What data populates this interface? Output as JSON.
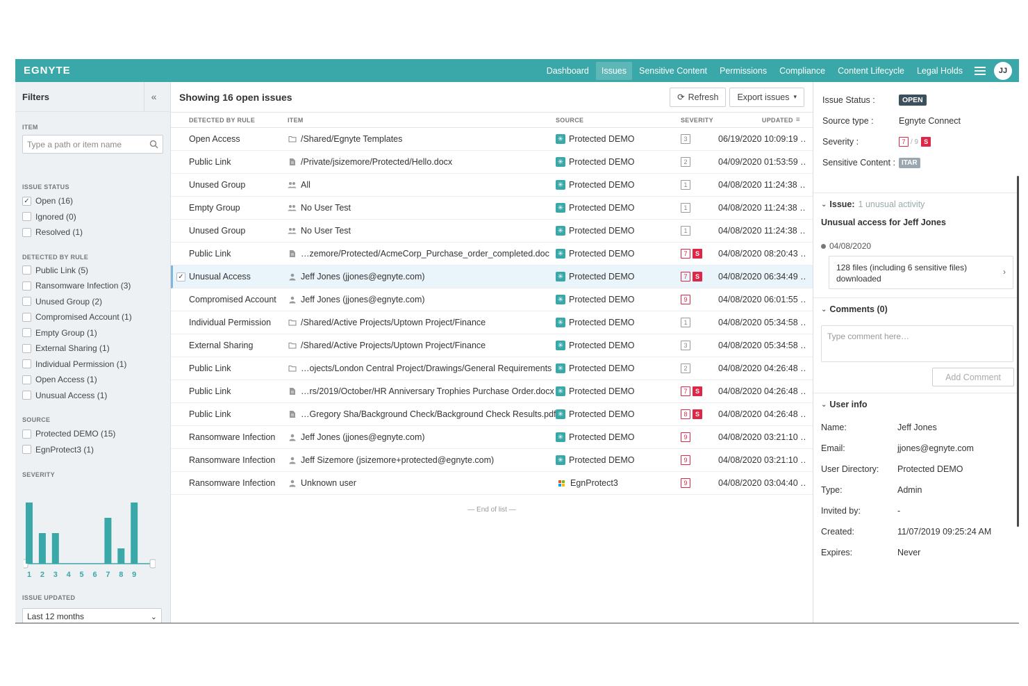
{
  "header": {
    "logo": "EGNYTE",
    "nav": [
      "Dashboard",
      "Issues",
      "Sensitive Content",
      "Permissions",
      "Compliance",
      "Content Lifecycle",
      "Legal Holds"
    ],
    "active_nav": "Issues",
    "avatar": "JJ"
  },
  "sidebar": {
    "title": "Filters",
    "collapse": "«",
    "item_label": "ITEM",
    "search_placeholder": "Type a path or item name",
    "issue_status_label": "ISSUE STATUS",
    "issue_status": [
      {
        "label": "Open (16)",
        "checked": true
      },
      {
        "label": "Ignored (0)",
        "checked": false
      },
      {
        "label": "Resolved (1)",
        "checked": false
      }
    ],
    "rule_label": "DETECTED BY RULE",
    "rules": [
      "Public Link (5)",
      "Ransomware Infection (3)",
      "Unused Group (2)",
      "Compromised Account (1)",
      "Empty Group (1)",
      "External Sharing (1)",
      "Individual Permission (1)",
      "Open Access (1)",
      "Unusual Access (1)"
    ],
    "source_label": "SOURCE",
    "sources": [
      "Protected DEMO (15)",
      "EgnProtect3 (1)"
    ],
    "severity_label": "SEVERITY",
    "severity_ticks": [
      "1",
      "2",
      "3",
      "4",
      "5",
      "6",
      "7",
      "8",
      "9"
    ],
    "severity_counts": [
      4,
      2,
      2,
      0,
      0,
      0,
      3,
      1,
      4
    ],
    "issue_updated_label": "ISSUE UPDATED",
    "issue_updated_value": "Last 12 months"
  },
  "main": {
    "title": "Showing 16 open issues",
    "refresh": "Refresh",
    "export": "Export issues",
    "columns": {
      "rule": "DETECTED BY RULE",
      "item": "ITEM",
      "source": "SOURCE",
      "severity": "SEVERITY",
      "updated": "UPDATED"
    },
    "rows": [
      {
        "rule": "Open Access",
        "icon": "folder-icon",
        "item": "/Shared/Egnyte Templates",
        "source": "Protected DEMO",
        "sev": "3",
        "s": false,
        "red": false,
        "updated": "06/19/2020 10:09:19 …"
      },
      {
        "rule": "Public Link",
        "icon": "file-icon",
        "item": "/Private/jsizemore/Protected/Hello.docx",
        "source": "Protected DEMO",
        "sev": "2",
        "s": false,
        "red": false,
        "updated": "04/09/2020 01:53:59 …"
      },
      {
        "rule": "Unused Group",
        "icon": "group-icon",
        "item": "All",
        "source": "Protected DEMO",
        "sev": "1",
        "s": false,
        "red": false,
        "updated": "04/08/2020 11:24:38 …"
      },
      {
        "rule": "Empty Group",
        "icon": "group-icon",
        "item": "No User Test",
        "source": "Protected DEMO",
        "sev": "1",
        "s": false,
        "red": false,
        "updated": "04/08/2020 11:24:38 …"
      },
      {
        "rule": "Unused Group",
        "icon": "group-icon",
        "item": "No User Test",
        "source": "Protected DEMO",
        "sev": "1",
        "s": false,
        "red": false,
        "updated": "04/08/2020 11:24:38 …"
      },
      {
        "rule": "Public Link",
        "icon": "file-icon",
        "item": "…zemore/Protected/AcmeCorp_Purchase_order_completed.doc",
        "source": "Protected DEMO",
        "sev": "7",
        "s": true,
        "red": true,
        "updated": "04/08/2020 08:20:43 …"
      },
      {
        "rule": "Unusual Access",
        "icon": "user-icon",
        "item": "Jeff Jones (jjones@egnyte.com)",
        "source": "Protected DEMO",
        "sev": "7",
        "s": true,
        "red": true,
        "updated": "04/08/2020 06:34:49 …",
        "selected": true
      },
      {
        "rule": "Compromised Account",
        "icon": "user-icon",
        "item": "Jeff Jones (jjones@egnyte.com)",
        "source": "Protected DEMO",
        "sev": "9",
        "s": false,
        "red": true,
        "updated": "04/08/2020 06:01:55 …"
      },
      {
        "rule": "Individual Permission",
        "icon": "folder-icon",
        "item": "/Shared/Active Projects/Uptown Project/Finance",
        "source": "Protected DEMO",
        "sev": "1",
        "s": false,
        "red": false,
        "updated": "04/08/2020 05:34:58 …"
      },
      {
        "rule": "External Sharing",
        "icon": "folder-icon",
        "item": "/Shared/Active Projects/Uptown Project/Finance",
        "source": "Protected DEMO",
        "sev": "3",
        "s": false,
        "red": false,
        "updated": "04/08/2020 05:34:58 …"
      },
      {
        "rule": "Public Link",
        "icon": "folder-icon",
        "item": "…ojects/London Central Project/Drawings/General Requirements",
        "source": "Protected DEMO",
        "sev": "2",
        "s": false,
        "red": false,
        "updated": "04/08/2020 04:26:48 …"
      },
      {
        "rule": "Public Link",
        "icon": "file-icon",
        "item": "…rs/2019/October/HR Anniversary Trophies Purchase Order.docx",
        "source": "Protected DEMO",
        "sev": "7",
        "s": true,
        "red": true,
        "updated": "04/08/2020 04:26:48 …"
      },
      {
        "rule": "Public Link",
        "icon": "file-icon",
        "item": "…Gregory Sha/Background Check/Background Check Results.pdf",
        "source": "Protected DEMO",
        "sev": "8",
        "s": true,
        "red": true,
        "updated": "04/08/2020 04:26:48 …"
      },
      {
        "rule": "Ransomware Infection",
        "icon": "user-icon",
        "item": "Jeff Jones (jjones@egnyte.com)",
        "source": "Protected DEMO",
        "sev": "9",
        "s": false,
        "red": true,
        "updated": "04/08/2020 03:21:10 …"
      },
      {
        "rule": "Ransomware Infection",
        "icon": "user-icon",
        "item": "Jeff Sizemore (jsizemore+protected@egnyte.com)",
        "source": "Protected DEMO",
        "sev": "9",
        "s": false,
        "red": true,
        "updated": "04/08/2020 03:21:10 …"
      },
      {
        "rule": "Ransomware Infection",
        "icon": "user-icon",
        "item": "Unknown user",
        "source": "EgnProtect3",
        "ms": true,
        "sev": "9",
        "s": false,
        "red": true,
        "updated": "04/08/2020 03:04:40 …"
      }
    ],
    "end_of_list": "— End of list —"
  },
  "detail": {
    "issue_status_k": "Issue Status :",
    "issue_status_v": "OPEN",
    "source_type_k": "Source type :",
    "source_type_v": "Egnyte Connect",
    "severity_k": "Severity :",
    "severity_num": "7",
    "severity_of": "/ 9",
    "severity_s": "S",
    "sensitive_k": "Sensitive Content :",
    "sensitive_v": "ITAR",
    "issue_head": "Issue:",
    "issue_sub": "1 unusual activity",
    "issue_title": "Unusual access for Jeff Jones",
    "event_date": "04/08/2020",
    "event_text": "128 files (including 6 sensitive files) downloaded",
    "comments_head": "Comments (0)",
    "comment_placeholder": "Type comment here…",
    "add_comment": "Add Comment",
    "user_info_head": "User info",
    "user_info": [
      {
        "k": "Name:",
        "v": "Jeff Jones"
      },
      {
        "k": "Email:",
        "v": "jjones@egnyte.com"
      },
      {
        "k": "User Directory:",
        "v": "Protected DEMO"
      },
      {
        "k": "Type:",
        "v": "Admin"
      },
      {
        "k": "Invited by:",
        "v": "-"
      },
      {
        "k": "Created:",
        "v": "11/07/2019 09:25:24 AM"
      },
      {
        "k": "Expires:",
        "v": "Never"
      }
    ]
  },
  "colors": {
    "brand": "#3aa8a8",
    "danger": "#e02646",
    "open_badge": "#3e4f5c"
  }
}
